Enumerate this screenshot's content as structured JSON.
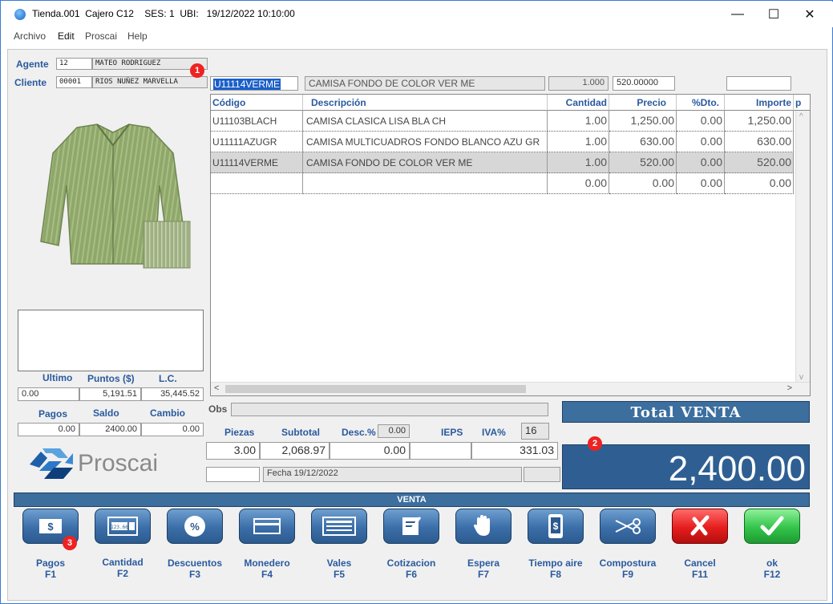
{
  "window": {
    "title": "Tienda.001  Cajero C12    SES: 1  UBI:   19/12/2022 10:10:00",
    "minimize": "—",
    "maximize": "☐",
    "close": "✕"
  },
  "menu": [
    "Archivo",
    "Edit",
    "Proscai",
    "Help"
  ],
  "agent": {
    "label": "Agente",
    "code": "12",
    "name": "MATEO RODRIGUEZ"
  },
  "client": {
    "label": "Cliente",
    "code": "00001",
    "name": "RIOS NUÑEZ MARVELLA"
  },
  "entry": {
    "code": "U11114VERME",
    "description": "CAMISA FONDO DE COLOR VER ME",
    "quantity": "1.000",
    "price": "520.00000",
    "extra": ""
  },
  "grid": {
    "headers": [
      "Código",
      "Descripción",
      "Cantidad",
      "Precio",
      "%Dto.",
      "Importe",
      "p"
    ],
    "rows": [
      {
        "code": "U11103BLACH",
        "desc": "CAMISA CLASICA LISA BLA CH",
        "qty": "1.00",
        "price": "1,250.00",
        "dto": "0.00",
        "importe": "1,250.00"
      },
      {
        "code": "U11111AZUGR",
        "desc": "CAMISA MULTICUADROS FONDO BLANCO AZU GR",
        "qty": "1.00",
        "price": "630.00",
        "dto": "0.00",
        "importe": "630.00"
      },
      {
        "code": "U11114VERME",
        "desc": "CAMISA FONDO DE COLOR VER ME",
        "qty": "1.00",
        "price": "520.00",
        "dto": "0.00",
        "importe": "520.00"
      },
      {
        "code": "",
        "desc": "",
        "qty": "0.00",
        "price": "0.00",
        "dto": "0.00",
        "importe": "0.00"
      }
    ]
  },
  "points": {
    "labels": [
      "Ultimo",
      "Puntos ($)",
      "L.C."
    ],
    "values": [
      "0.00",
      "5,191.51",
      "35,445.52"
    ]
  },
  "payments": {
    "labels": [
      "Pagos",
      "Saldo",
      "Cambio"
    ],
    "values": [
      "0.00",
      "2400.00",
      "0.00"
    ]
  },
  "logo": "Proscai",
  "obs_label": "Obs",
  "totals": {
    "labels": [
      "Piezas",
      "Subtotal",
      "Desc.%",
      "IEPS",
      "IVA%"
    ],
    "desc_pct": "0.00",
    "iva_pct": "16",
    "piezas": "3.00",
    "subtotal": "2,068.97",
    "desc": "0.00",
    "ieps": "",
    "iva": "331.03",
    "fecha": "Fecha 19/12/2022"
  },
  "total_header": "Total VENTA",
  "total_value": "2,400.00",
  "mode_bar": "VENTA",
  "badges": [
    "1",
    "2",
    "3"
  ],
  "buttons": [
    {
      "label": "Pagos",
      "key": "F1",
      "icon": "cash-icon"
    },
    {
      "label": "Cantidad",
      "key": "F2",
      "icon": "calculator-icon"
    },
    {
      "label": "Descuentos",
      "key": "F3",
      "icon": "percent-icon"
    },
    {
      "label": "Monedero",
      "key": "F4",
      "icon": "wallet-card-icon"
    },
    {
      "label": "Vales",
      "key": "F5",
      "icon": "voucher-icon"
    },
    {
      "label": "Cotizacion",
      "key": "F6",
      "icon": "quote-edit-icon"
    },
    {
      "label": "Espera",
      "key": "F7",
      "icon": "hand-stop-icon"
    },
    {
      "label": "Tiempo aire",
      "key": "F8",
      "icon": "phone-credit-icon"
    },
    {
      "label": "Compostura",
      "key": "F9",
      "icon": "scissors-icon"
    },
    {
      "label": "Cancel",
      "key": "F11",
      "icon": "cancel-x-icon"
    },
    {
      "label": "ok",
      "key": "F12",
      "icon": "checkmark-icon"
    }
  ],
  "button_calc_text": "123.66",
  "cash_symbol": "$",
  "percent_symbol": "%",
  "phone_symbol": "$"
}
